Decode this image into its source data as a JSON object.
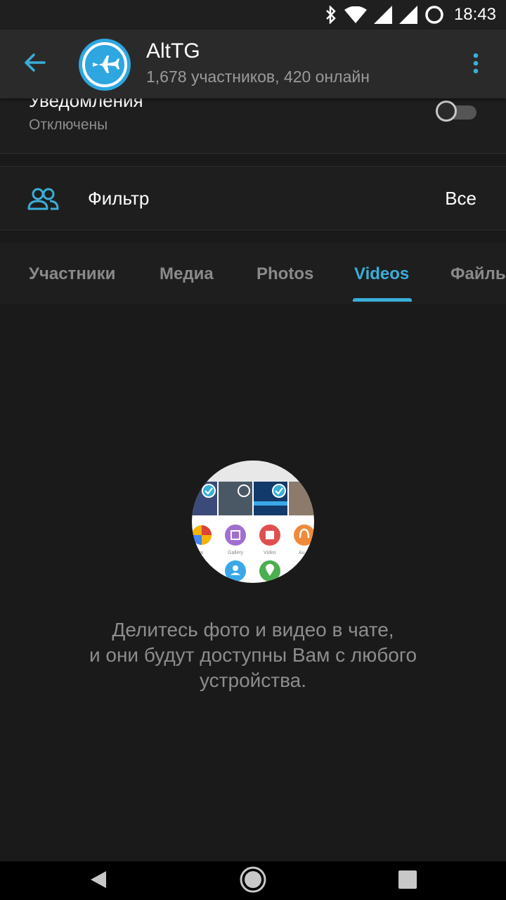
{
  "status_bar": {
    "time": "18:43",
    "icons": [
      "bluetooth-icon",
      "wifi-icon",
      "signal-icon",
      "signal-icon",
      "battery-icon"
    ]
  },
  "header": {
    "title": "AltTG",
    "subtitle": "1,678 участников, 420 онлайн",
    "back_icon": "arrow-left-icon",
    "menu_icon": "more-vertical-icon",
    "accent_color": "#3aaed8"
  },
  "notifications": {
    "title": "Уведомления",
    "status": "Отключены",
    "enabled": false
  },
  "filter": {
    "label": "Фильтр",
    "value": "Все",
    "icon": "people-icon"
  },
  "tabs": [
    {
      "label": "Участники",
      "active": false
    },
    {
      "label": "Медиа",
      "active": false
    },
    {
      "label": "Photos",
      "active": false
    },
    {
      "label": "Videos",
      "active": true
    },
    {
      "label": "Файлы",
      "active": false
    }
  ],
  "empty_state": {
    "lines": [
      "Делитесь фото и видео в чате,",
      "и они будут доступны Вам с любого",
      "устройства."
    ],
    "illustration_labels": [
      "nera",
      "Gallery",
      "Video",
      "Au"
    ]
  },
  "nav_bar": {
    "icons": [
      "back-triangle-icon",
      "home-circle-icon",
      "recents-square-icon"
    ]
  }
}
